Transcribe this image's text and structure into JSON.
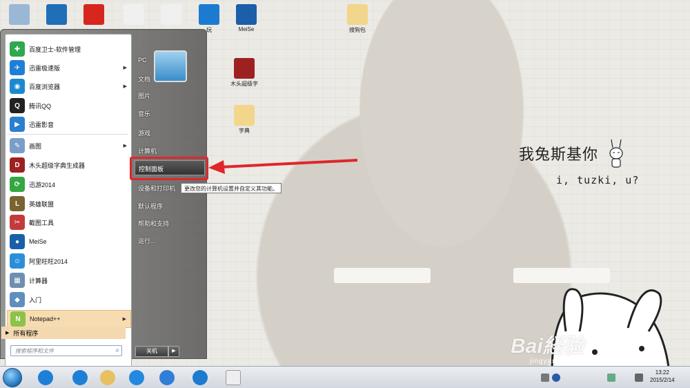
{
  "wallpaper": {
    "line1": "我兔斯基你",
    "line2": "i, tuzki, u?"
  },
  "desktop_icons": [
    {
      "label": "",
      "name": "recycle-bin-icon",
      "color": "#9ab8d6"
    },
    {
      "label": "",
      "name": "sync-icon",
      "color": "#1e6fb8"
    },
    {
      "label": "",
      "name": "red-app-icon",
      "color": "#d7261e"
    },
    {
      "label": "",
      "name": "document-icon",
      "color": "#f0f0f0"
    },
    {
      "label": "",
      "name": "shortcut-doc-icon",
      "color": "#f0f0f0"
    },
    {
      "label": "玩",
      "name": "baidu-browser-icon",
      "color": "#1c7bd0"
    },
    {
      "label": "MeiSe",
      "name": "meise-icon",
      "color": "#1b5fa8"
    },
    {
      "label": "搜狗包",
      "name": "folder-icon",
      "color": "#f1d68b"
    },
    {
      "label": "木头超级字典生成器",
      "name": "dic-icon",
      "color": "#9e2122"
    },
    {
      "label": "字典",
      "name": "folder-dict-icon",
      "color": "#f1d68b"
    }
  ],
  "start_menu": {
    "programs": [
      {
        "label": "百度卫士-软件管理",
        "color": "#2fa84f",
        "glyph": "✚",
        "submenu": false
      },
      {
        "label": "迅雷极速版",
        "color": "#1e7fd6",
        "glyph": "✈",
        "submenu": true
      },
      {
        "label": "百度浏览器",
        "color": "#1a8ad0",
        "glyph": "◉",
        "submenu": true
      },
      {
        "label": "腾讯QQ",
        "color": "#222222",
        "glyph": "Q",
        "submenu": false
      },
      {
        "label": "迅雷影音",
        "color": "#2a7fd0",
        "glyph": "▶",
        "submenu": false
      },
      {
        "label": "画图",
        "color": "#7a9ec8",
        "glyph": "✎",
        "submenu": true
      },
      {
        "label": "木头超级字典生成器",
        "color": "#9e2122",
        "glyph": "D",
        "submenu": false
      },
      {
        "label": "迅游2014",
        "color": "#35a742",
        "glyph": "⟳",
        "submenu": false
      },
      {
        "label": "英雄联盟",
        "color": "#7a6330",
        "glyph": "L",
        "submenu": false
      },
      {
        "label": "截图工具",
        "color": "#c33b3b",
        "glyph": "✂",
        "submenu": false
      },
      {
        "label": "MeiSe",
        "color": "#1b5fa8",
        "glyph": "●",
        "submenu": false
      },
      {
        "label": "阿里旺旺2014",
        "color": "#2b8fd8",
        "glyph": "☺",
        "submenu": false
      },
      {
        "label": "计算器",
        "color": "#6d8fb0",
        "glyph": "▦",
        "submenu": false
      },
      {
        "label": "入门",
        "color": "#5f8fbd",
        "glyph": "◆",
        "submenu": false
      },
      {
        "label": "Notepad++",
        "color": "#8bc34a",
        "glyph": "N",
        "submenu": true
      }
    ],
    "all_programs": "所有程序",
    "search_placeholder": "搜索程序和文件",
    "right_items": [
      "PC",
      "文档",
      "图片",
      "音乐",
      "游戏",
      "计算机",
      "控制面板",
      "设备和打印机",
      "默认程序",
      "帮助和支持",
      "运行..."
    ],
    "tooltip": "更改您的计算机设置并自定义其功能。",
    "shutdown": "关机"
  },
  "taskbar": {
    "pinned": [
      {
        "name": "ie-icon",
        "color": "#1e7fd6"
      },
      {
        "name": "xunlei-icon",
        "color": "#1e7fd6"
      },
      {
        "name": "explorer-icon",
        "color": "#e8c060"
      },
      {
        "name": "kugou-icon",
        "color": "#2389e0"
      },
      {
        "name": "baidu-cloud-icon",
        "color": "#2f7fd6"
      },
      {
        "name": "baidu-browser-icon",
        "color": "#1c7bd0"
      },
      {
        "name": "tuzki-app-icon",
        "color": "#eeeeee"
      }
    ],
    "time": "13:22",
    "date": "2015/2/14"
  },
  "watermark": {
    "brand": "Bai経验",
    "url": "jingyan.baidu.com"
  }
}
